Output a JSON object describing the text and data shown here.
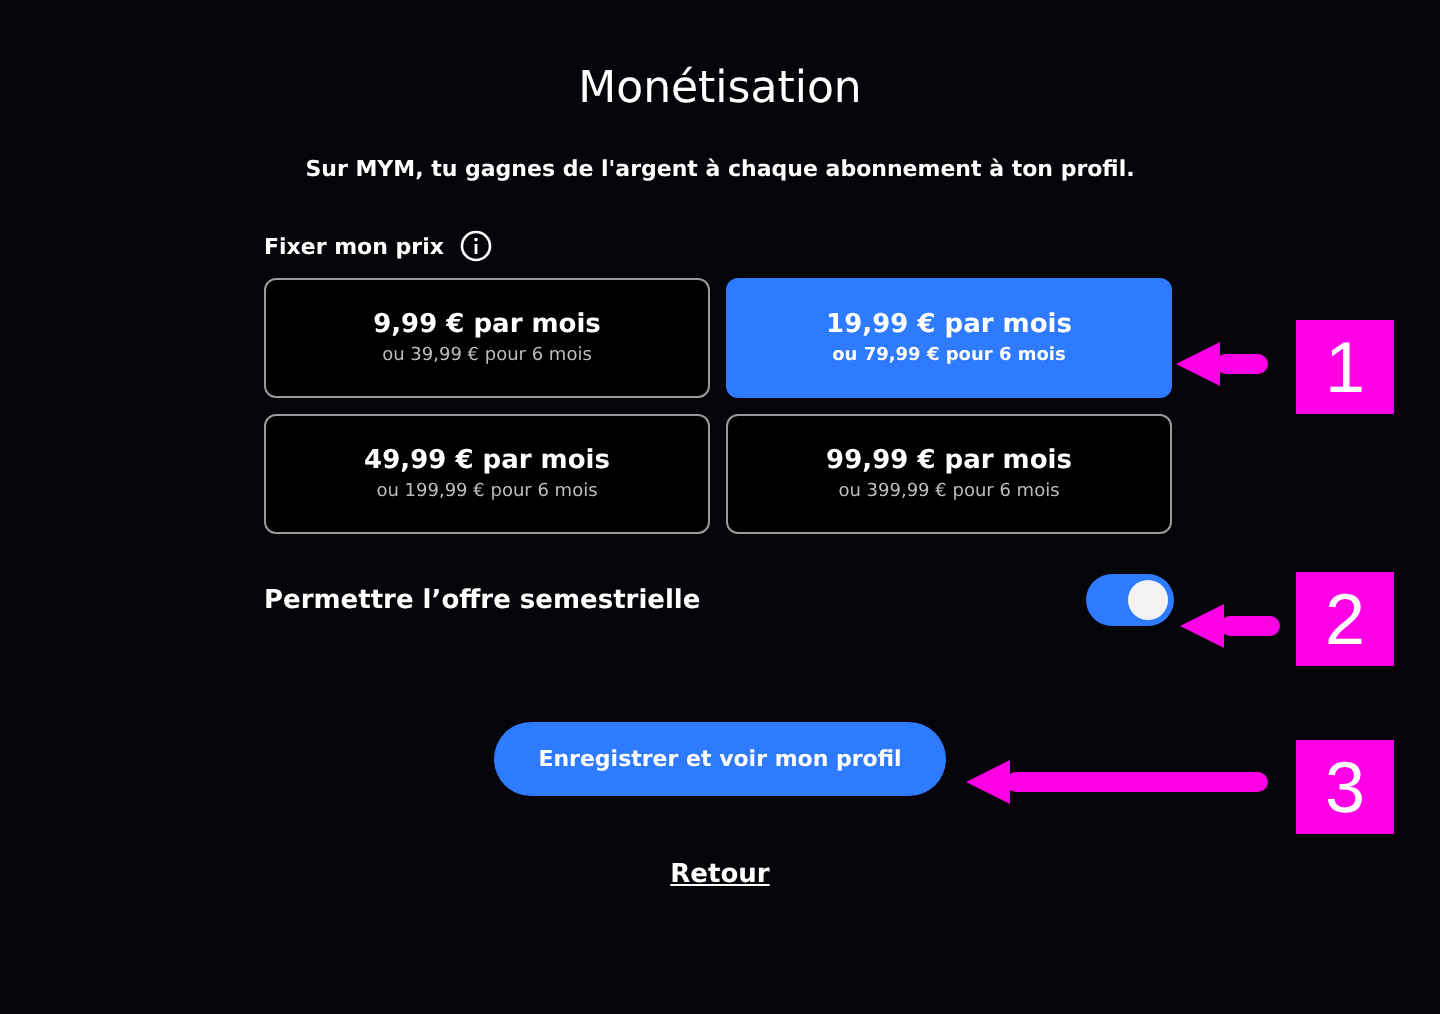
{
  "title": "Monétisation",
  "subtitle": "Sur MYM, tu gagnes de l'argent à chaque abonnement à ton profil.",
  "price_label": "Fixer mon prix",
  "prices": [
    {
      "monthly": "9,99 € par mois",
      "six_months": "ou 39,99 € pour 6 mois",
      "selected": false
    },
    {
      "monthly": "19,99 € par mois",
      "six_months": "ou 79,99 € pour 6 mois",
      "selected": true
    },
    {
      "monthly": "49,99 € par mois",
      "six_months": "ou 199,99 € pour 6 mois",
      "selected": false
    },
    {
      "monthly": "99,99 € par mois",
      "six_months": "ou 399,99 € pour 6 mois",
      "selected": false
    }
  ],
  "semester_offer": {
    "label": "Permettre l’offre semestrielle",
    "on": true
  },
  "save_button": "Enregistrer et voir mon profil",
  "back_link": "Retour",
  "callouts": [
    {
      "label": "1"
    },
    {
      "label": "2"
    },
    {
      "label": "3"
    }
  ]
}
